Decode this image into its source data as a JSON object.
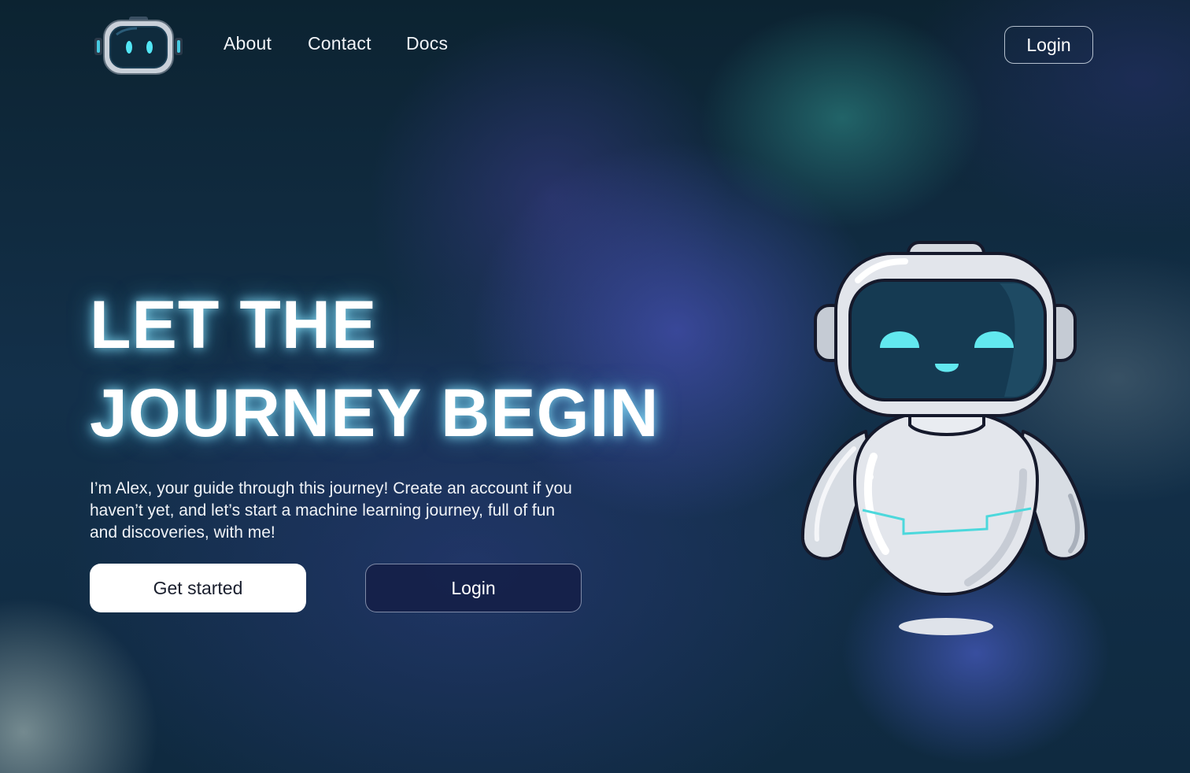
{
  "nav": {
    "logo_icon": "robot-head-icon",
    "links": [
      {
        "label": "About"
      },
      {
        "label": "Contact"
      },
      {
        "label": "Docs"
      }
    ],
    "login_label": "Login"
  },
  "hero": {
    "title_line1": "LET THE",
    "title_line2": "JOURNEY BEGIN",
    "description": "I’m Alex, your guide through this journey! Create an account if you haven’t yet, and let’s start a machine learning journey, full of fun and discoveries, with me!",
    "primary_button": "Get started",
    "secondary_button": "Login",
    "illustration_icon": "robot-mascot-icon"
  },
  "colors": {
    "accent_cyan": "#5ee6ec",
    "title_glow": "#8ce6ff",
    "background_dark": "#0c2331"
  }
}
